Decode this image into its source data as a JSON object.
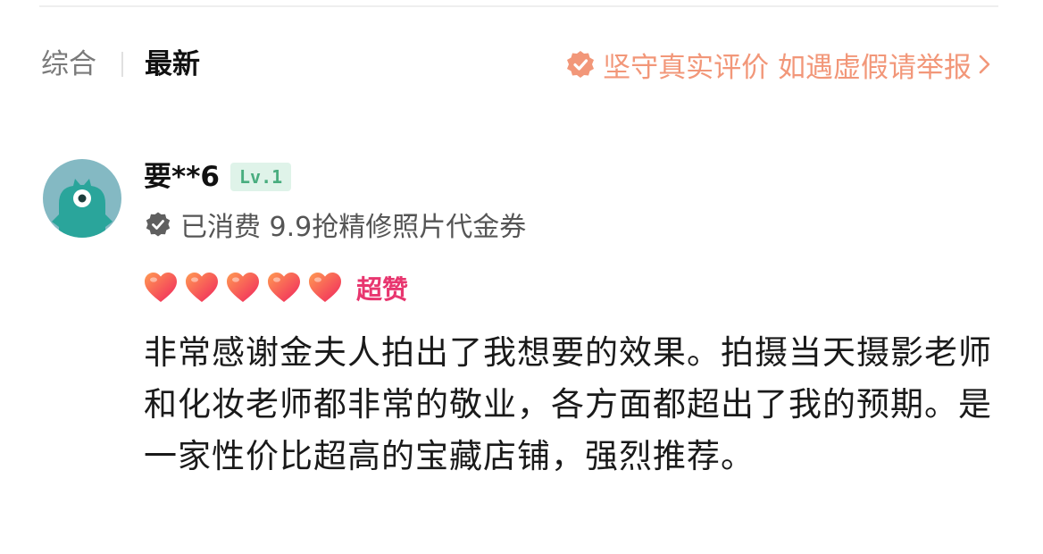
{
  "tabs": {
    "all_label": "综合",
    "latest_label": "最新"
  },
  "notice": {
    "text": "坚守真实评价 如遇虚假请举报",
    "icon": "shield-check-icon",
    "chevron_icon": "chevron-right-icon",
    "color": "#f29779"
  },
  "review": {
    "user": {
      "name": "要**6",
      "level": "Lv.1",
      "avatar_icon": "monster-avatar-icon"
    },
    "consumed_text": "已消费 9.9抢精修照片代金券",
    "rating": {
      "stars": 5,
      "max": 5,
      "label": "超赞",
      "icon": "heart-icon"
    },
    "body": "非常感谢金夫人拍出了我想要的效果。拍摄当天摄影老师和化妆老师都非常的敬业，各方面都超出了我的预期。是一家性价比超高的宝藏店铺，强烈推荐。"
  },
  "colors": {
    "accent": "#e8366f",
    "notice": "#f29779",
    "level_bg": "#dff3e9",
    "level_text": "#49ad7f",
    "avatar_bg": "#84b9c3",
    "avatar_creature": "#2aa59b"
  }
}
